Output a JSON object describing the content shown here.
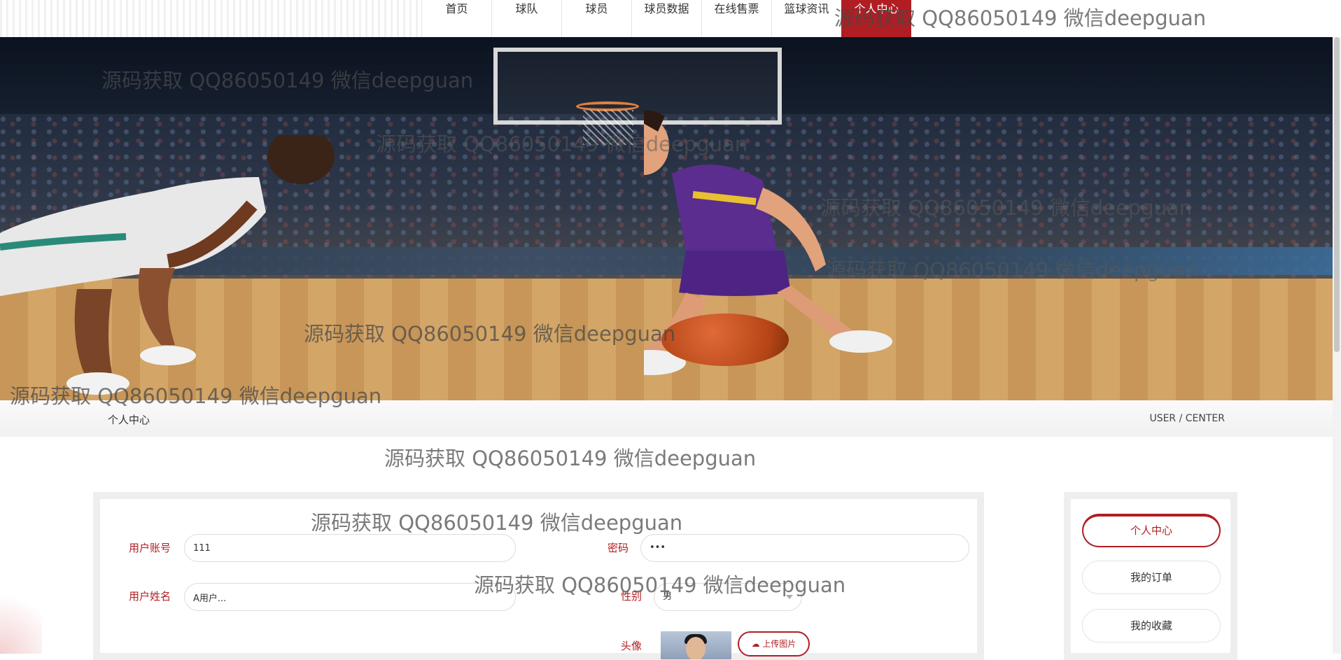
{
  "nav": {
    "items": [
      {
        "label": "首页"
      },
      {
        "label": "球队"
      },
      {
        "label": "球员"
      },
      {
        "label": "球员数据"
      },
      {
        "label": "在线售票"
      },
      {
        "label": "篮球资讯"
      },
      {
        "label": "个人中心",
        "active": true
      }
    ]
  },
  "banner": {
    "slides": 3,
    "active_slide": 1
  },
  "section": {
    "title": "个人中心",
    "subtitle": "USER / CENTER"
  },
  "form": {
    "account_label": "用户账号",
    "account_value": "111",
    "password_label": "密码",
    "password_value": "•••",
    "name_label": "用户姓名",
    "name_value": "A用户...",
    "gender_label": "性别",
    "gender_value": "男",
    "avatar_label": "头像",
    "upload_label": "上传图片"
  },
  "sidebar": {
    "items": [
      {
        "label": "个人中心",
        "active": true
      },
      {
        "label": "我的订单"
      },
      {
        "label": "我的收藏"
      }
    ]
  },
  "watermark": "源码获取 QQ86050149 微信deepguan",
  "colors": {
    "accent": "#b01e23",
    "panel_bg": "#eeeeee"
  }
}
